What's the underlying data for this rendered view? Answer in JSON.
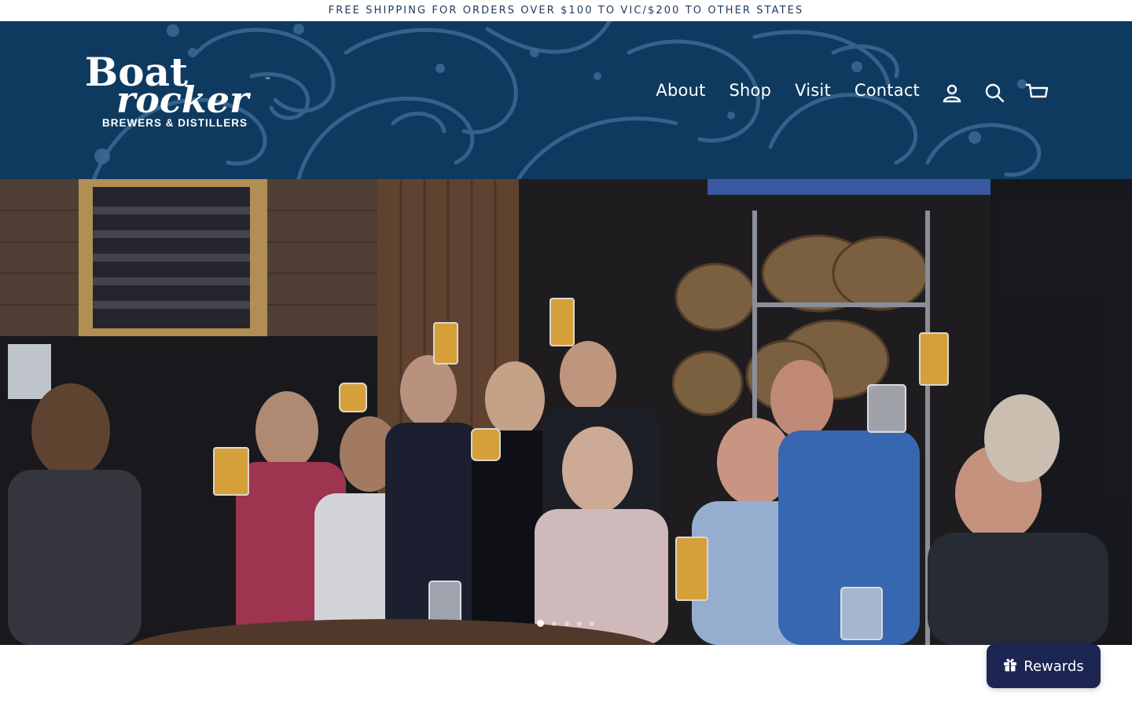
{
  "announcement": {
    "text": "FREE SHIPPING FOR ORDERS OVER $100 TO VIC/$200 TO OTHER STATES"
  },
  "brand": {
    "logo_lines": [
      "Boat",
      "rocker"
    ],
    "logo_mark": "™",
    "tagline": "BREWERS & DISTILLERS"
  },
  "nav": {
    "items": [
      {
        "label": "About"
      },
      {
        "label": "Shop"
      },
      {
        "label": "Visit"
      },
      {
        "label": "Contact"
      }
    ],
    "icons": [
      "account-icon",
      "search-icon",
      "cart-icon"
    ]
  },
  "hero": {
    "slide_count": 5,
    "active_slide": 1
  },
  "rewards": {
    "label": "Rewards",
    "icon": "gift-icon"
  },
  "colors": {
    "header_bg": "#0f3a5f",
    "wave_stroke": "#3a6a92",
    "announcement_text": "#1d3a5e",
    "rewards_bg": "#1d2552"
  }
}
